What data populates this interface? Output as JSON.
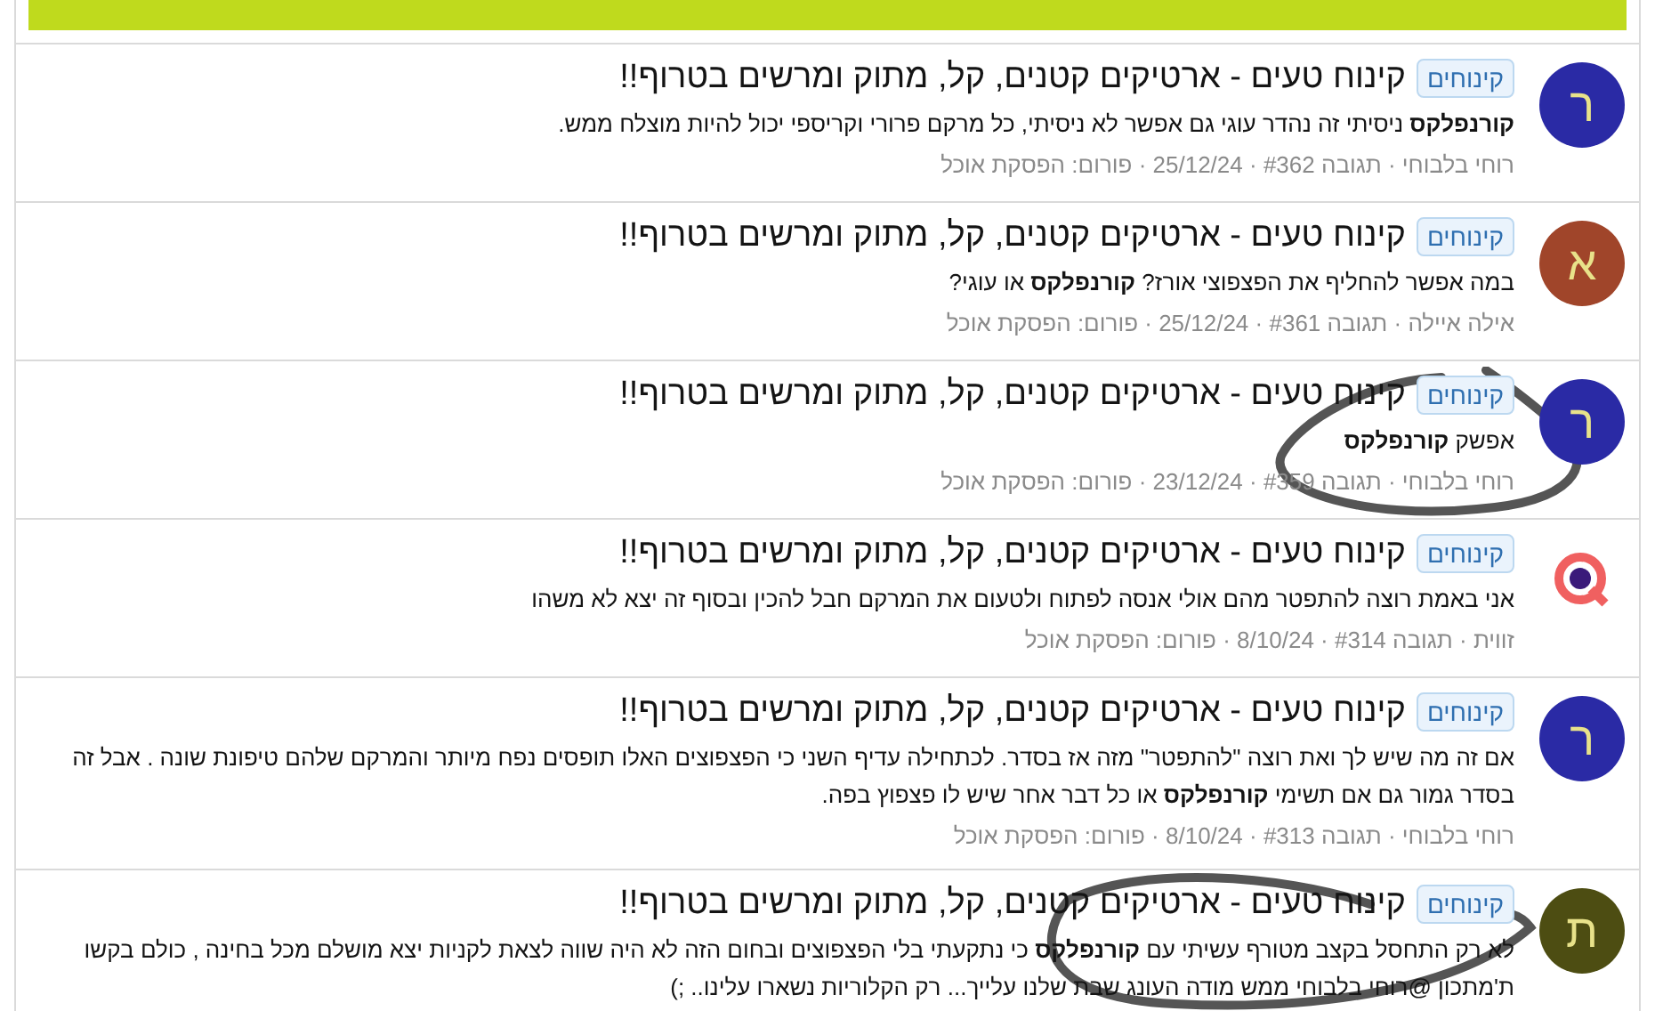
{
  "results": [
    {
      "avatar": {
        "kind": "letter",
        "letter": "ר",
        "color": "#2a2aa5"
      },
      "tag": "קינוחים",
      "title": "קינוח טעים - ארטיקים קטנים, קל, מתוק ומרשים בטרוף!!",
      "snippet": "**קורנפלקס** ניסיתי זה נהדר עוגי גם אפשר לא ניסיתי, כל מרקם פרורי וקריספי יכול להיות מוצלח ממש.",
      "meta": "רוחי בלבוחי · תגובה #362 · 25/12/24 · פורום: הפסקת אוכל"
    },
    {
      "avatar": {
        "kind": "letter",
        "letter": "א",
        "color": "#a0452a"
      },
      "tag": "קינוחים",
      "title": "קינוח טעים - ארטיקים קטנים, קל, מתוק ומרשים בטרוף!!",
      "snippet": "במה אפשר להחליף את הפצפוצי אורז? **קורנפלקס** או עוגי?",
      "meta": "אילה איילה · תגובה #361 · 25/12/24 · פורום: הפסקת אוכל"
    },
    {
      "avatar": {
        "kind": "letter",
        "letter": "ר",
        "color": "#2a2aa5"
      },
      "tag": "קינוחים",
      "title": "קינוח טעים - ארטיקים קטנים, קל, מתוק ומרשים בטרוף!!",
      "snippet": "אפשק **קורנפלקס**",
      "meta": "רוחי בלבוחי · תגובה #359 · 23/12/24 · פורום: הפסקת אוכל"
    },
    {
      "avatar": {
        "kind": "logo"
      },
      "tag": "קינוחים",
      "title": "קינוח טעים - ארטיקים קטנים, קל, מתוק ומרשים בטרוף!!",
      "snippet": "אני באמת רוצה להתפטר מהם אולי אנסה לפתוח ולטעום את המרקם חבל להכין ובסוף זה יצא לא משהו",
      "meta": "זווית · תגובה #314 · 8/10/24 · פורום: הפסקת אוכל"
    },
    {
      "avatar": {
        "kind": "letter",
        "letter": "ר",
        "color": "#2a2aa5"
      },
      "tag": "קינוחים",
      "title": "קינוח טעים - ארטיקים קטנים, קל, מתוק ומרשים בטרוף!!",
      "snippet": "אם זה מה שיש לך ואת רוצה \"להתפטר\" מזה אז בסדר. לכתחילה עדיף השני כי הפצפוצים האלו תופסים נפח מיותר והמרקם שלהם טיפונת שונה . אבל זה בסדר גמור גם אם תשימי **קורנפלקס** או כל דבר אחר שיש לו פצפוץ בפה.",
      "meta": "רוחי בלבוחי · תגובה #313 · 8/10/24 · פורום: הפסקת אוכל"
    },
    {
      "avatar": {
        "kind": "letter",
        "letter": "ת",
        "color": "#4d4d12"
      },
      "tag": "קינוחים",
      "title": "קינוח טעים - ארטיקים קטנים, קל, מתוק ומרשים בטרוף!!",
      "snippet": "לא רק התחסל בקצב מטורף עשיתי עם **קורנפלקס** כי נתקעתי בלי הפצפוצים ובחום הזה לא היה שווה לצאת לקניות יצא מושלם מכל בחינה , כולם בקשו ת'מתכון @רוחי בלבוחי ממש מודה העונג שבת שלנו עלייך... רק הקלוריות נשארו עלינו.. ;)"
    }
  ],
  "scribbles": [
    {
      "kind": "loop"
    },
    {
      "kind": "loop"
    }
  ]
}
